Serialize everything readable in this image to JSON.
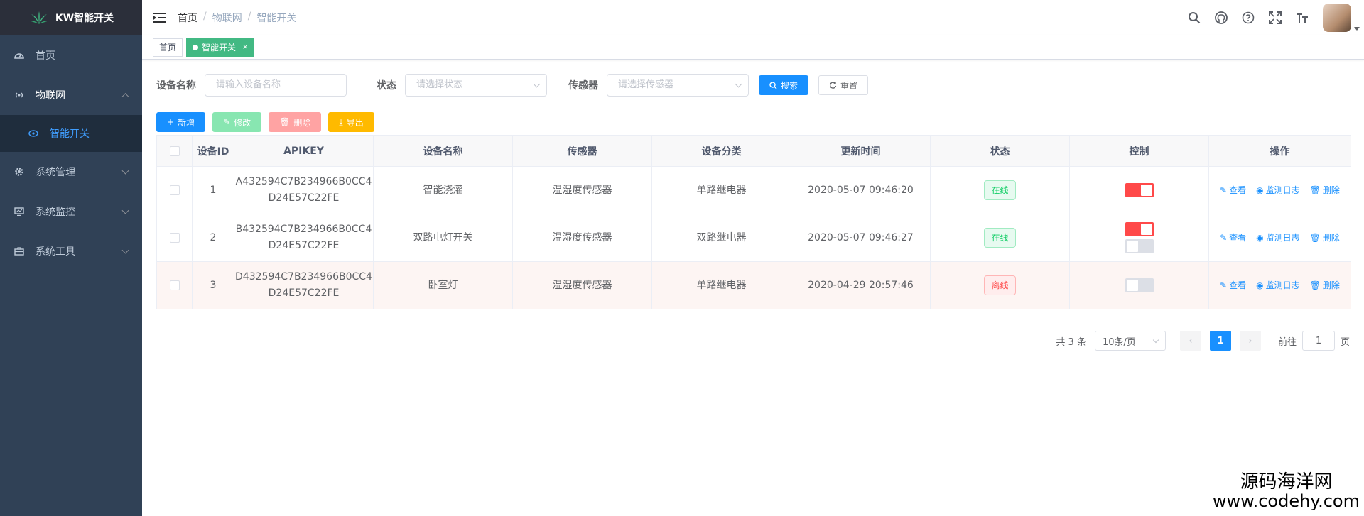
{
  "app": {
    "title": "KW智能开关"
  },
  "sidebar": {
    "items": [
      {
        "label": "首页",
        "icon": "dashboard-icon"
      },
      {
        "label": "物联网",
        "icon": "broadcast-icon",
        "expanded": true,
        "children": [
          {
            "label": "智能开关",
            "icon": "eye-icon"
          }
        ]
      },
      {
        "label": "系统管理",
        "icon": "gear-icon"
      },
      {
        "label": "系统监控",
        "icon": "monitor-icon"
      },
      {
        "label": "系统工具",
        "icon": "toolbox-icon"
      }
    ]
  },
  "breadcrumb": [
    "首页",
    "物联网",
    "智能开关"
  ],
  "tags": {
    "home": "首页",
    "active": "智能开关",
    "close": "×"
  },
  "search": {
    "device_name_label": "设备名称",
    "device_name_placeholder": "请输入设备名称",
    "status_label": "状态",
    "status_placeholder": "请选择状态",
    "sensor_label": "传感器",
    "sensor_placeholder": "请选择传感器",
    "search_btn": "搜索",
    "reset_btn": "重置"
  },
  "toolbar": {
    "add": "新增",
    "edit": "修改",
    "delete": "删除",
    "export": "导出"
  },
  "table": {
    "columns": [
      "设备ID",
      "APIKEY",
      "设备名称",
      "传感器",
      "设备分类",
      "更新时间",
      "状态",
      "控制",
      "操作"
    ],
    "rows": [
      {
        "id": "1",
        "apikey1": "A432594C7B234966B0CC4",
        "apikey2": "D24E57C22FE",
        "name": "智能浇灌",
        "sensor": "温湿度传感器",
        "category": "单路继电器",
        "time": "2020-05-07 09:46:20",
        "status": "在线",
        "switches": [
          "on"
        ]
      },
      {
        "id": "2",
        "apikey1": "B432594C7B234966B0CC4",
        "apikey2": "D24E57C22FE",
        "name": "双路电灯开关",
        "sensor": "温湿度传感器",
        "category": "双路继电器",
        "time": "2020-05-07 09:46:27",
        "status": "在线",
        "switches": [
          "on",
          "off"
        ]
      },
      {
        "id": "3",
        "apikey1": "D432594C7B234966B0CC4",
        "apikey2": "D24E57C22FE",
        "name": "卧室灯",
        "sensor": "温湿度传感器",
        "category": "单路继电器",
        "time": "2020-04-29 20:57:46",
        "status": "离线",
        "switches": [
          "off"
        ]
      }
    ],
    "ops": {
      "view": "查看",
      "log": "监测日志",
      "delete": "删除"
    }
  },
  "pagination": {
    "total": "共 3 条",
    "page_size": "10条/页",
    "current": "1",
    "goto_prefix": "前往",
    "goto_value": "1",
    "goto_suffix": "页"
  },
  "watermark": {
    "line1": "源码海洋网",
    "line2": "www.codehy.com"
  }
}
